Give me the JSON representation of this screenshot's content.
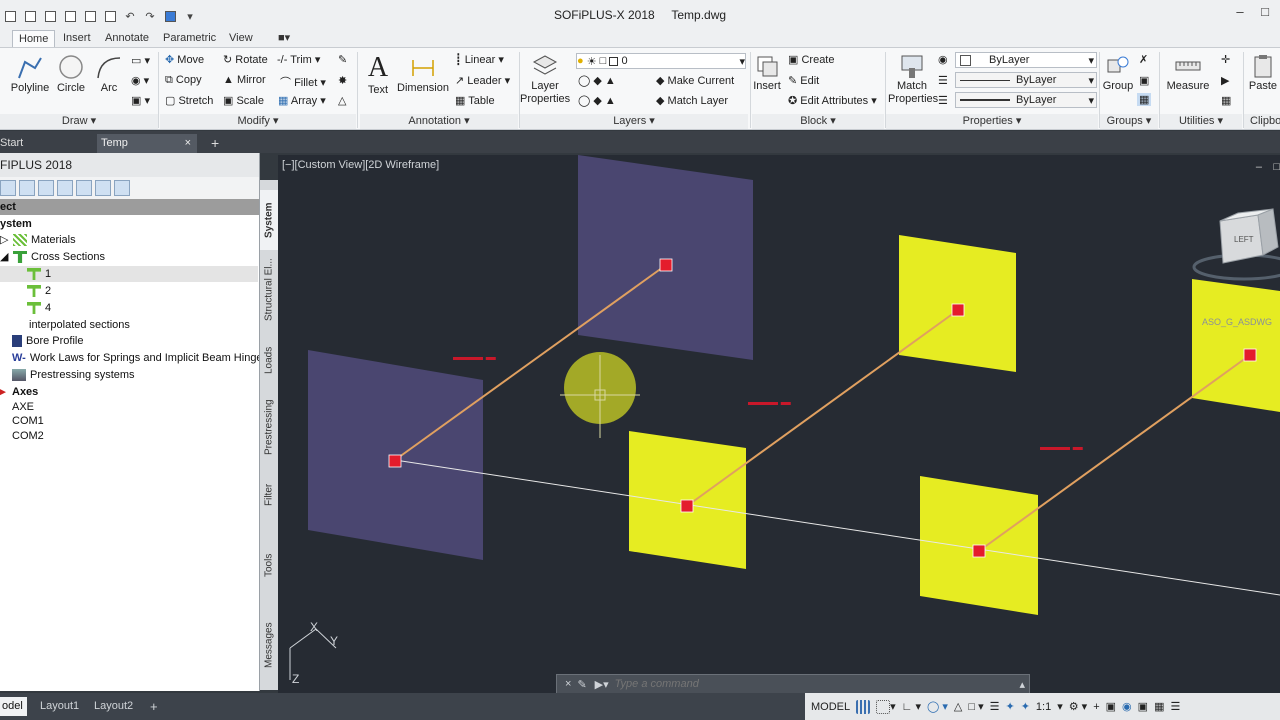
{
  "window": {
    "title": "SOFiPLUS-X 2018",
    "file": "Temp.dwg"
  },
  "ribbon": {
    "tabs": [
      "Home",
      "Insert",
      "Annotate",
      "Parametric",
      "View"
    ],
    "draw": {
      "title": "Draw",
      "polyline": "Polyline",
      "circle": "Circle",
      "arc": "Arc"
    },
    "modify": {
      "title": "Modify",
      "move": "Move",
      "rotate": "Rotate",
      "trim": "Trim",
      "copy": "Copy",
      "mirror": "Mirror",
      "fillet": "Fillet",
      "stretch": "Stretch",
      "scale": "Scale",
      "array": "Array"
    },
    "annotation": {
      "title": "Annotation",
      "text": "Text",
      "dimension": "Dimension",
      "linear": "Linear",
      "leader": "Leader",
      "table": "Table"
    },
    "layers": {
      "title": "Layers",
      "layer_properties": "Layer Properties",
      "current_layer": "0",
      "make_current": "Make Current",
      "match_layer": "Match Layer"
    },
    "block": {
      "title": "Block",
      "insert": "Insert",
      "create": "Create",
      "edit": "Edit",
      "edit_attributes": "Edit Attributes"
    },
    "properties": {
      "title": "Properties",
      "match_properties": "Match Properties",
      "color": "ByLayer",
      "linetype": "ByLayer",
      "lineweight": "ByLayer"
    },
    "groups": {
      "title": "Groups",
      "group": "Group"
    },
    "utilities": {
      "title": "Utilities",
      "measure": "Measure"
    },
    "clipboard": {
      "title": "Clipbo",
      "paste": "Paste"
    }
  },
  "doc_tabs": {
    "start": "Start",
    "temp": "Temp"
  },
  "palette": {
    "title": "FIPLUS 2018",
    "header": "ect",
    "items": {
      "system": "ystem",
      "materials": "Materials",
      "cross_sections": "Cross Sections",
      "cs1": "1",
      "cs2": "2",
      "cs4": "4",
      "interpolated": "interpolated sections",
      "bore_profile": "Bore Profile",
      "work_laws": "Work Laws for Springs and Implicit Beam Hinges",
      "prestressing": "Prestressing systems",
      "axes": "Axes",
      "axe": "AXE",
      "com1": "COM1",
      "com2": "COM2"
    },
    "side_tabs": [
      "System",
      "Structural El...",
      "Loads",
      "Prestressing",
      "Filter",
      "Tools",
      "Messages"
    ]
  },
  "viewport": {
    "label": "[−][Custom View][2D Wireframe]",
    "viewcube_face": "LEFT",
    "wcs_label": "ASO_G_ASDWG"
  },
  "command": {
    "placeholder": "Type a command"
  },
  "status": {
    "layout_tabs": [
      "odel",
      "Layout1",
      "Layout2"
    ],
    "model": "MODEL",
    "scale": "1:1"
  },
  "colors": {
    "viewport_bg": "#262b33",
    "yellow_section": "#e6ec22",
    "purple_section": "#4a4670",
    "beam": "#e0a060",
    "node": "#e41c2c"
  }
}
